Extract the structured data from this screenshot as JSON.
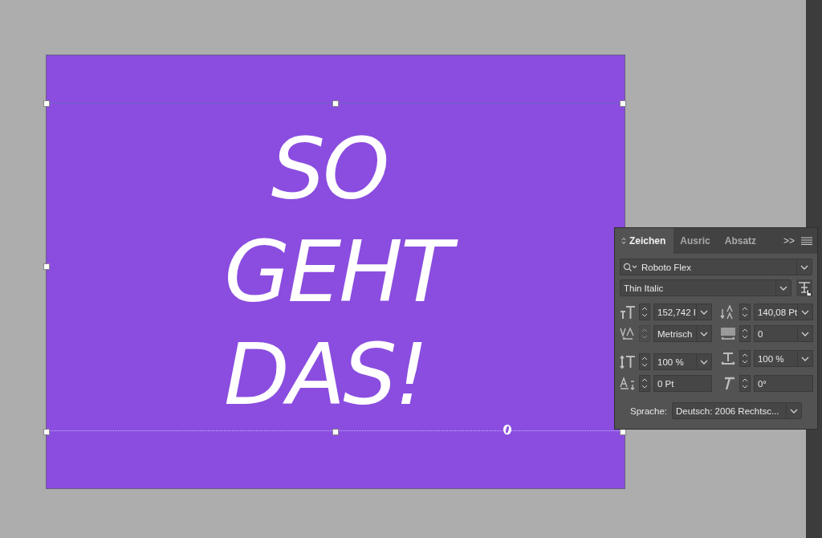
{
  "headline": [
    "SO",
    "GEHT",
    "DAS!"
  ],
  "panel": {
    "tabs": [
      {
        "label": "Zeichen",
        "selected": true
      },
      {
        "label": "Ausric",
        "selected": false
      },
      {
        "label": "Absatz",
        "selected": false
      }
    ],
    "overflow": ">>",
    "font_family": "Roboto Flex",
    "font_style": "Thin Italic",
    "fields": [
      {
        "kind": "dropdown",
        "value": "152,742 I",
        "disabled": false
      },
      {
        "kind": "dropdown",
        "value": "140,08 Pt",
        "disabled": false
      },
      {
        "kind": "dropdown",
        "value": "Metrisch",
        "disabled": true
      },
      {
        "kind": "dropdown",
        "value": "0",
        "disabled": false
      },
      {
        "kind": "dropdown",
        "value": "100 %",
        "disabled": false
      },
      {
        "kind": "dropdown",
        "value": "100 %",
        "disabled": false
      },
      {
        "kind": "plain",
        "value": "0 Pt",
        "disabled": false
      },
      {
        "kind": "plain",
        "value": "0°",
        "disabled": false
      }
    ],
    "language_label": "Sprache:",
    "language": "Deutsch: 2006 Rechtsc..."
  }
}
